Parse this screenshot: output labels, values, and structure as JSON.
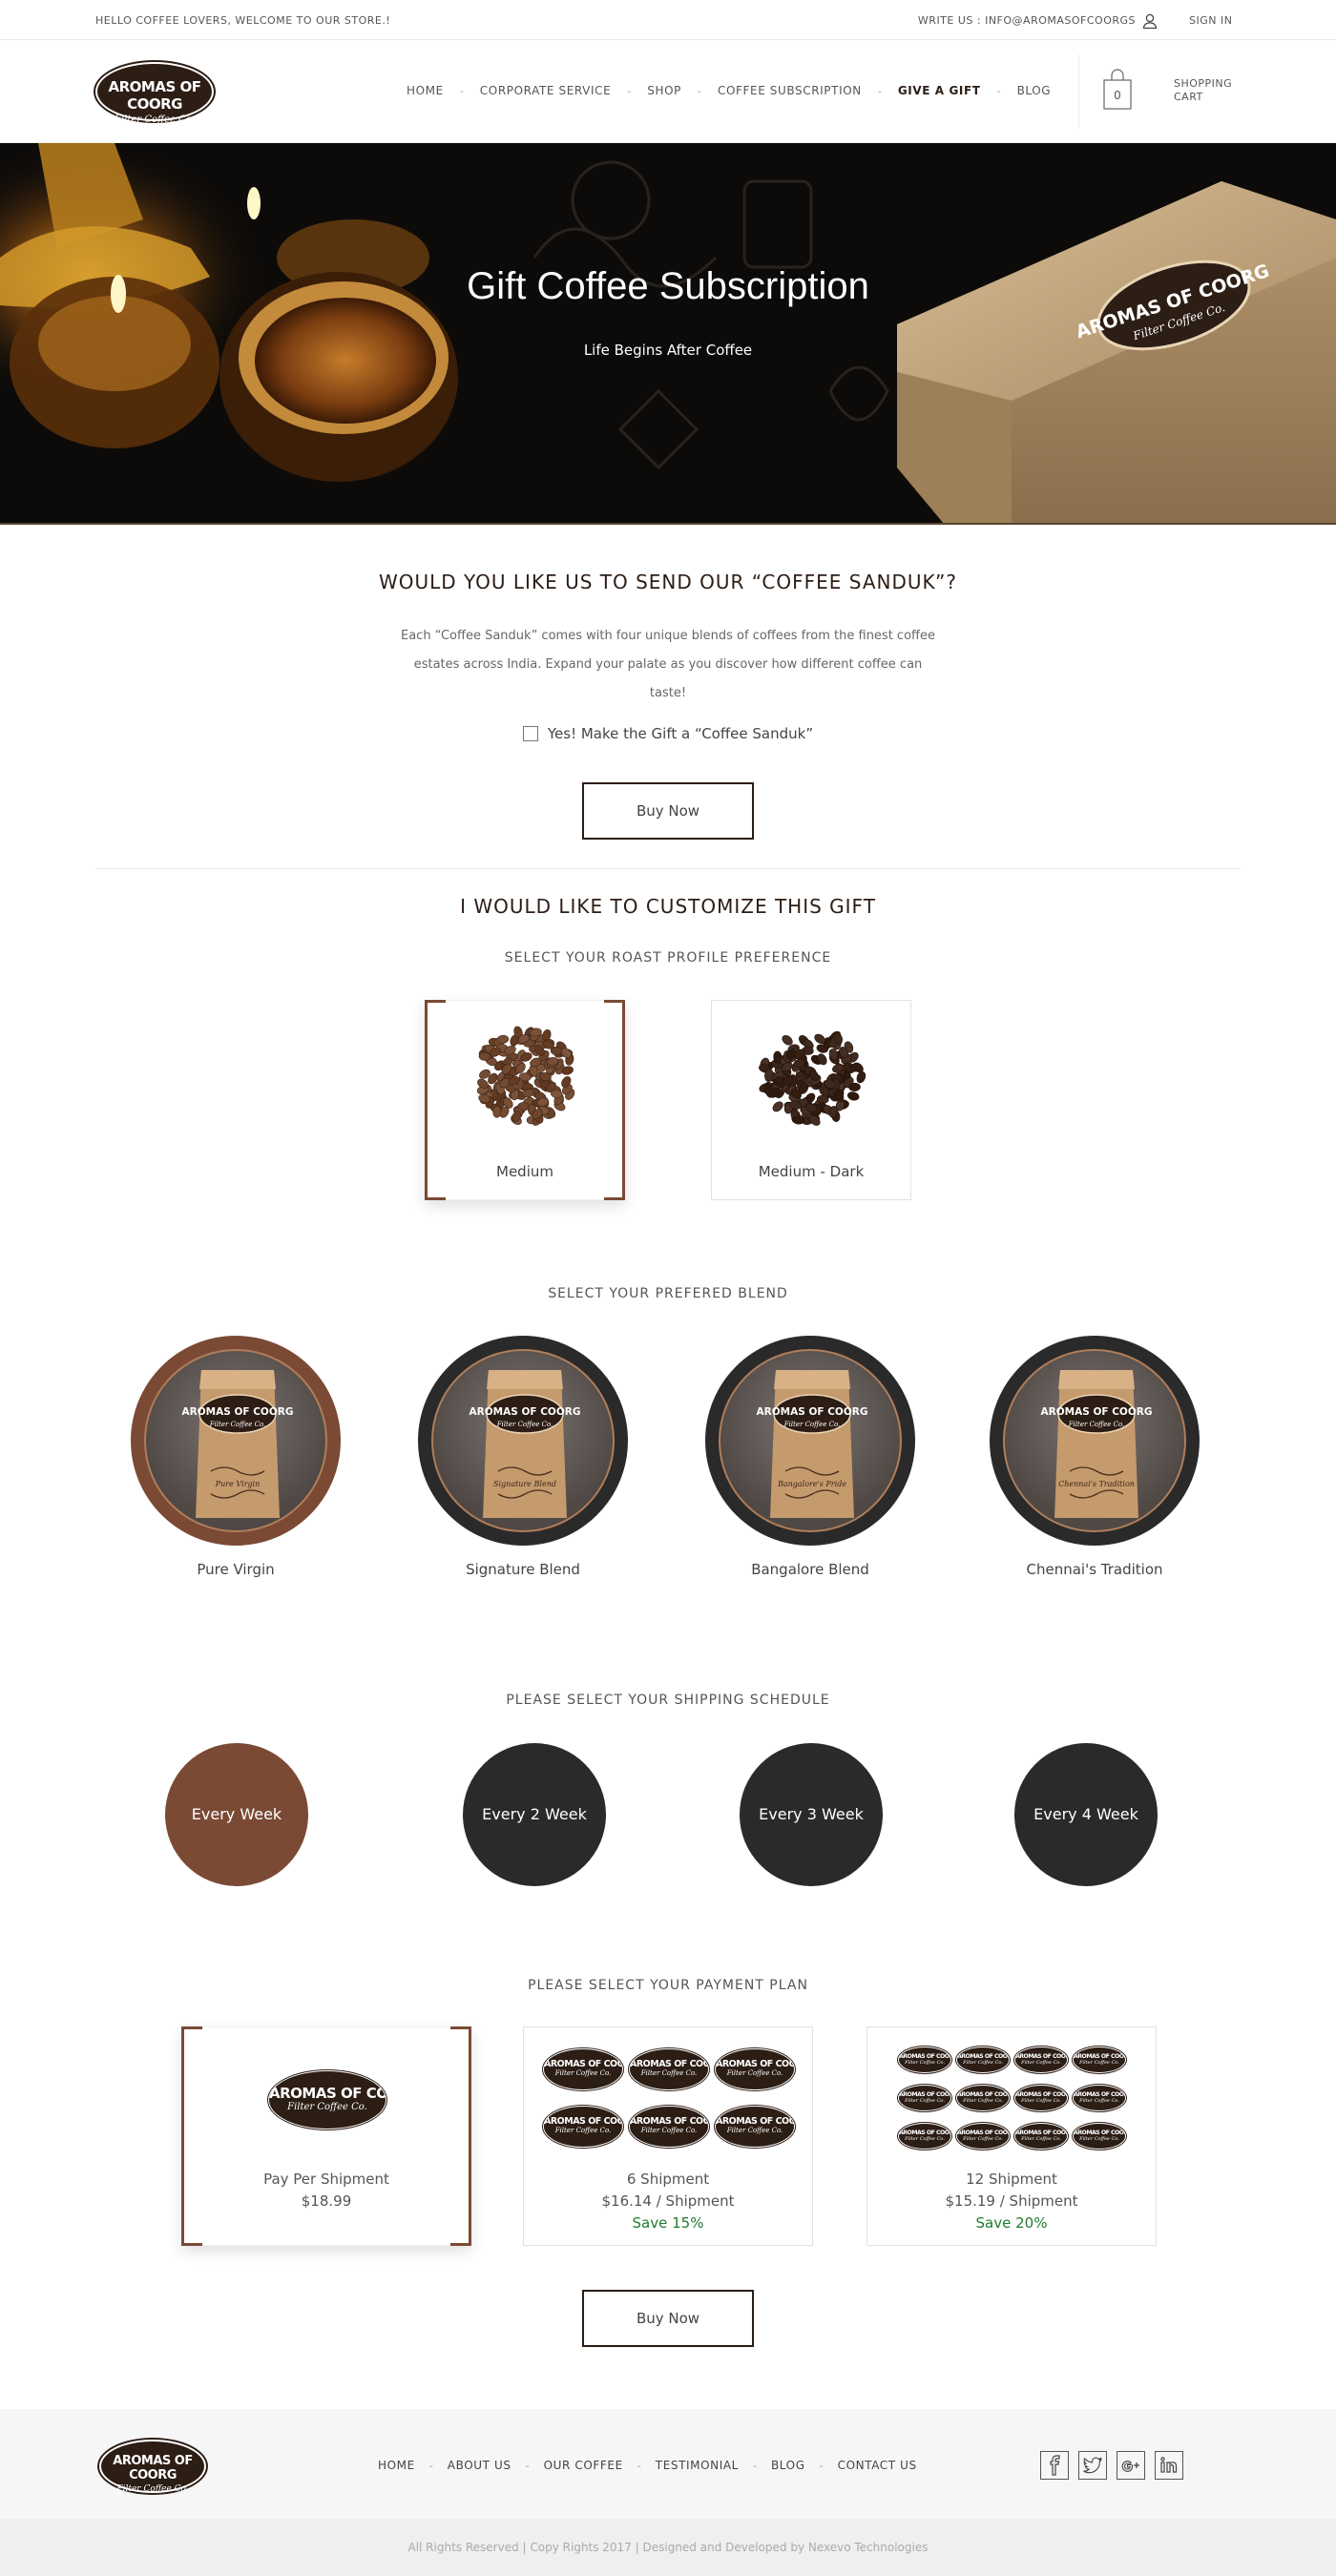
{
  "topbar": {
    "welcome": "HELLO COFFEE LOVERS, WELCOME TO OUR STORE.!",
    "write_us": "WRITE US : INFO@AROMASOFCOORGS",
    "sign_in": "SIGN IN"
  },
  "brand": {
    "line1": "AROMAS OF COORG",
    "line2": "Filter Coffee Co."
  },
  "nav": {
    "items": [
      "HOME",
      "CORPORATE SERVICE",
      "SHOP",
      "COFFEE SUBSCRIPTION",
      "GIVE A GIFT",
      "BLOG"
    ],
    "separator": "-",
    "active": "GIVE A GIFT"
  },
  "cart": {
    "count": "0",
    "label": "SHOPPING CART"
  },
  "hero": {
    "title": "Gift Coffee Subscription",
    "subtitle": "Life Begins After Coffee"
  },
  "sanduk": {
    "title": "WOULD YOU LIKE US TO SEND OUR “COFFEE SANDUK”?",
    "description": "Each “Coffee Sanduk” comes with four unique blends of coffees from the finest coffee estates across India. Expand your palate as you discover how different coffee can taste!",
    "checkbox_label": "Yes! Make the Gift a “Coffee Sanduk”",
    "checkbox_checked": false,
    "buy_label": "Buy Now"
  },
  "customize": {
    "title": "I WOULD LIKE TO CUSTOMIZE THIS GIFT",
    "roast_label": "SELECT YOUR ROAST PROFILE PREFERENCE",
    "roasts": [
      {
        "name": "Medium",
        "selected": true
      },
      {
        "name": "Medium - Dark",
        "selected": false
      }
    ],
    "blend_label": "SELECT YOUR PREFERED BLEND",
    "blends": [
      {
        "name": "Pure Virgin",
        "bag_text": "Pure Virgin",
        "selected": true
      },
      {
        "name": "Signature Blend",
        "bag_text": "Signature Blend",
        "selected": false
      },
      {
        "name": "Bangalore Blend",
        "bag_text": "Bangalore's Pride",
        "selected": false
      },
      {
        "name": "Chennai's Tradition",
        "bag_text": "Chennai's Tradition",
        "selected": false
      }
    ],
    "shipping_label": "PLEASE SELECT YOUR SHIPPING SCHEDULE",
    "shipping": [
      {
        "label": "Every Week",
        "selected": true
      },
      {
        "label": "Every 2 Week",
        "selected": false
      },
      {
        "label": "Every 3 Week",
        "selected": false
      },
      {
        "label": "Every 4 Week",
        "selected": false
      }
    ],
    "payment_label": "PLEASE SELECT YOUR PAYMENT PLAN",
    "payments": [
      {
        "title": "Pay Per Shipment",
        "price": "$18.99",
        "save": "",
        "selected": true,
        "logos": 1
      },
      {
        "title": "6 Shipment",
        "price": "$16.14 / Shipment",
        "save": "Save 15%",
        "selected": false,
        "logos": 6
      },
      {
        "title": "12 Shipment",
        "price": "$15.19 / Shipment",
        "save": "Save 20%",
        "selected": false,
        "logos": 12
      }
    ],
    "buy_label": "Buy Now"
  },
  "footer": {
    "nav": [
      "HOME",
      "ABOUT US",
      "OUR COFFEE",
      "TESTIMONIAL",
      "BLOG",
      "CONTACT US"
    ],
    "separator": "-",
    "social": [
      "facebook-icon",
      "twitter-icon",
      "google-plus-icon",
      "linkedin-icon"
    ],
    "copyright": "All Rights Reserved | Copy Rights 2017 | Designed and Developed by Nexevo Technologies"
  },
  "colors": {
    "brand_dark": "#2c1d15",
    "selected_brown": "#7a4a35",
    "unselected_dark": "#2a2a2a",
    "save_green": "#1f7a2e"
  }
}
